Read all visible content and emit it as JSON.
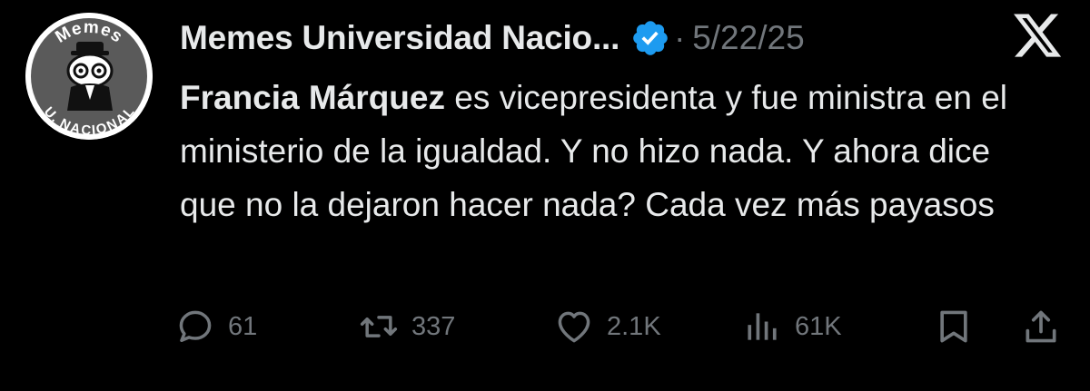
{
  "header": {
    "display_name": "Memes Universidad Nacio...",
    "separator": "·",
    "date": "5/22/25"
  },
  "avatar": {
    "text_top": "Memes",
    "text_bottom": "U. NACIONAL"
  },
  "tweet": {
    "mention": "Francia Márquez",
    "text": " es vicepresidenta y fue ministra en el ministerio de la igualdad. Y no hizo nada. Y ahora dice que no la dejaron hacer nada? Cada vez más payasos"
  },
  "actions": {
    "replies": "61",
    "reposts": "337",
    "likes": "2.1K",
    "views": "61K"
  },
  "icons": [
    "verified-badge-icon",
    "x-logo-icon",
    "reply-icon",
    "repost-icon",
    "like-icon",
    "views-icon",
    "bookmark-icon",
    "share-icon"
  ],
  "colors": {
    "background": "#000000",
    "text": "#e7e9ea",
    "muted": "#71767b",
    "verified": "#1d9bf0"
  }
}
